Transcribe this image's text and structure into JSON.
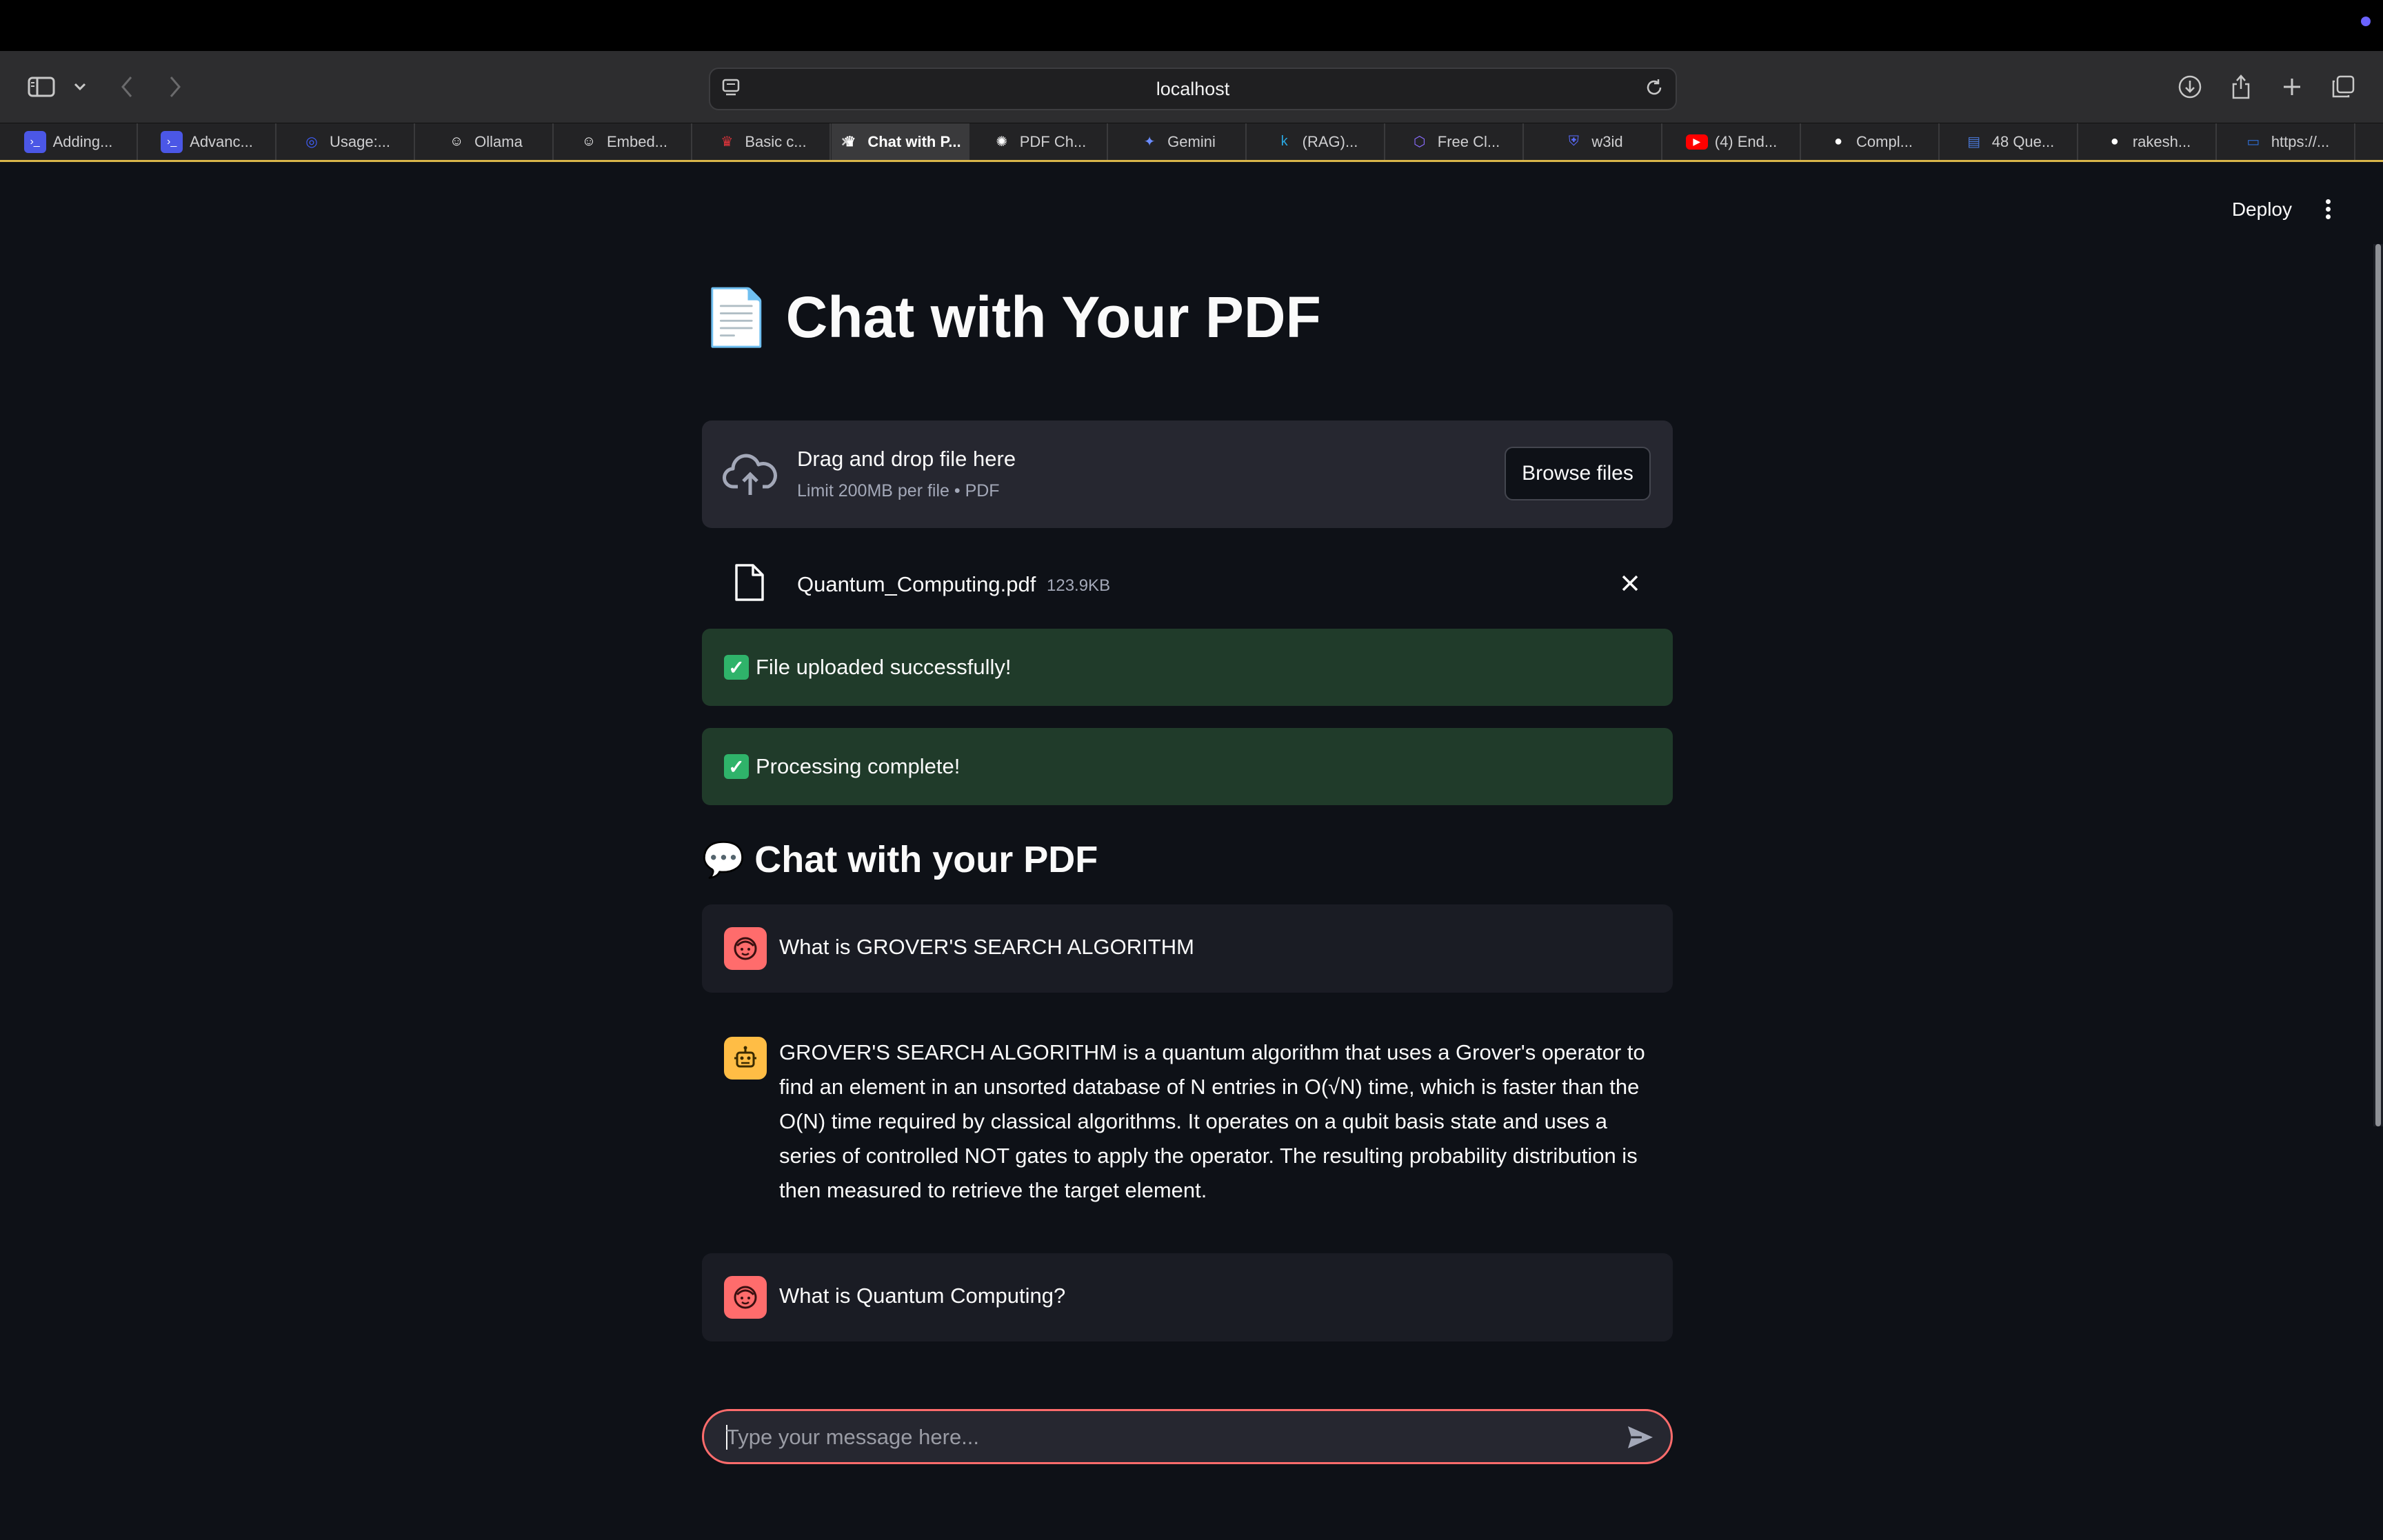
{
  "browser": {
    "url": "localhost",
    "tabs": [
      {
        "label": "Adding...",
        "icon": "terminal-icon",
        "color": "#4b57e6"
      },
      {
        "label": "Advanc...",
        "icon": "terminal-icon",
        "color": "#4b57e6"
      },
      {
        "label": "Usage:...",
        "icon": "circle-logo-icon",
        "color": "#3f5efb"
      },
      {
        "label": "Ollama",
        "icon": "ollama-icon",
        "color": "#ffffff"
      },
      {
        "label": "Embed...",
        "icon": "ollama-icon",
        "color": "#ffffff"
      },
      {
        "label": "Basic c...",
        "icon": "crown-icon",
        "color": "#e2343b"
      },
      {
        "label": "Chat with P...",
        "icon": "streamlit-icon",
        "color": "#ffffff",
        "active": true
      },
      {
        "label": "PDF Ch...",
        "icon": "openai-icon",
        "color": "#ffffff"
      },
      {
        "label": "Gemini",
        "icon": "sparkle-icon",
        "color": "#6b8cff"
      },
      {
        "label": "(RAG)...",
        "icon": "k-icon",
        "color": "#2aa7e0"
      },
      {
        "label": "Free Cl...",
        "icon": "cube-icon",
        "color": "#8a6cff"
      },
      {
        "label": "w3id",
        "icon": "shield-icon",
        "color": "#5b6cff"
      },
      {
        "label": "(4) End...",
        "icon": "youtube-icon",
        "color": "#ff0000"
      },
      {
        "label": "Compl...",
        "icon": "github-icon",
        "color": "#ffffff"
      },
      {
        "label": "48 Que...",
        "icon": "doc-icon",
        "color": "#4a78d6"
      },
      {
        "label": "rakesh...",
        "icon": "github-icon",
        "color": "#ffffff"
      },
      {
        "label": "https://...",
        "icon": "cds-icon",
        "color": "#2f6fd6"
      }
    ]
  },
  "header": {
    "deploy_label": "Deploy"
  },
  "main": {
    "title_emoji": "📄",
    "title": "Chat with Your PDF",
    "uploader": {
      "drag_text": "Drag and drop file here",
      "limit_text": "Limit 200MB per file • PDF",
      "browse_label": "Browse files"
    },
    "file": {
      "name": "Quantum_Computing.pdf",
      "size": "123.9KB"
    },
    "alerts": [
      {
        "text": "File uploaded successfully!"
      },
      {
        "text": "Processing complete!"
      }
    ],
    "chat_title_emoji": "💬",
    "chat_title": "Chat with your PDF",
    "messages": [
      {
        "role": "user",
        "text": "What is GROVER'S SEARCH ALGORITHM"
      },
      {
        "role": "assistant",
        "text": "GROVER'S SEARCH ALGORITHM is a quantum algorithm that uses a Grover's operator to find an element in an unsorted database of N entries in O(√N) time, which is faster than the O(N) time required by classical algorithms. It operates on a qubit basis state and uses a series of controlled NOT gates to apply the operator. The resulting probability distribution is then measured to retrieve the target element."
      },
      {
        "role": "user",
        "text": "What is Quantum Computing?"
      }
    ],
    "input_placeholder": "Type your message here..."
  },
  "colors": {
    "background": "#0e1117",
    "user_avatar": "#ff6c6c",
    "bot_avatar": "#ffbd45",
    "success_bg": "#203b2a",
    "input_border": "#ff6c6c"
  }
}
